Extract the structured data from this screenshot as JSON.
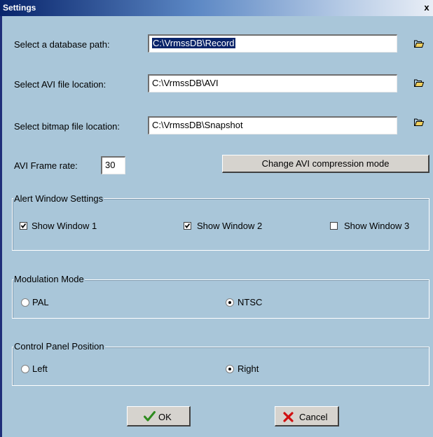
{
  "window": {
    "title": "Settings",
    "close_label": "x"
  },
  "paths": {
    "database": {
      "label": "Select a database path:",
      "value": "C:\\VrmssDB\\Record"
    },
    "avi": {
      "label": "Select AVI file location:",
      "value": "C:\\VrmssDB\\AVI"
    },
    "bitmap": {
      "label": "Select bitmap file location:",
      "value": "C:\\VrmssDB\\Snapshot"
    }
  },
  "frame_rate": {
    "label": "AVI Frame rate:",
    "value": "30"
  },
  "compression_button": "Change AVI compression mode",
  "alert_window": {
    "title": "Alert Window Settings",
    "options": [
      {
        "label": "Show Window 1",
        "checked": true
      },
      {
        "label": "Show Window 2",
        "checked": true
      },
      {
        "label": "Show Window 3",
        "checked": false
      }
    ]
  },
  "modulation": {
    "title": "Modulation Mode",
    "options": [
      {
        "label": "PAL",
        "selected": false
      },
      {
        "label": "NTSC",
        "selected": true
      }
    ]
  },
  "control_panel": {
    "title": "Control Panel Position",
    "options": [
      {
        "label": "Left",
        "selected": false
      },
      {
        "label": "Right",
        "selected": true
      }
    ]
  },
  "buttons": {
    "ok": "OK",
    "cancel": "Cancel"
  },
  "colors": {
    "dialog_bg": "#a9c6d9",
    "title_bar": "#08246b",
    "selection": "#0a246a",
    "ok_check": "#2e8b1e",
    "cancel_x": "#d01010",
    "folder": "#f0d060"
  },
  "icons": {
    "browse": "folder-icon",
    "ok": "checkmark-icon",
    "cancel": "x-icon",
    "close": "close-icon"
  }
}
